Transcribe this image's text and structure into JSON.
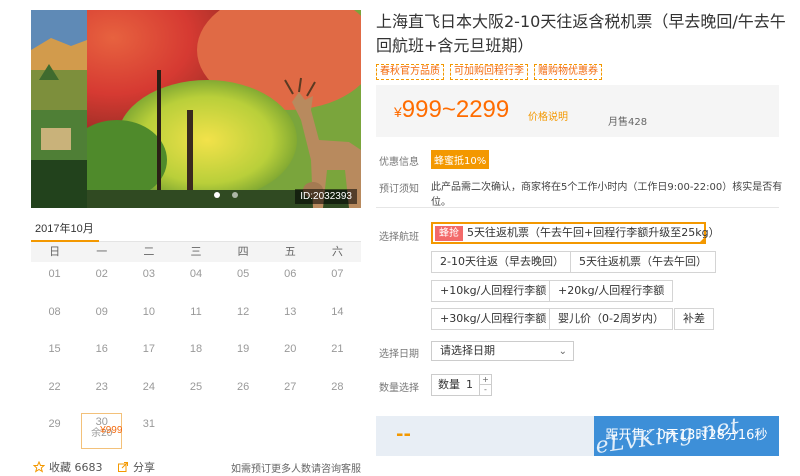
{
  "product": {
    "title": "上海直飞日本大阪2-10天往返含税机票（早去晚回/午去午回航班+含元旦班期）",
    "tags": [
      "春秋官方品质",
      "可加购回程行李",
      "赠购物优惠券"
    ],
    "image_id": "ID:2032393"
  },
  "price": {
    "range": "999~2299",
    "currency": "¥",
    "note": "价格说明",
    "sold": "月售428"
  },
  "promo": {
    "label": "优惠信息",
    "badge": "蜂蜜抵10%"
  },
  "notice": {
    "label": "预订须知",
    "text": "此产品需二次确认，商家将在5个工作小时内（工作日9:00-22:00）核实是否有位。"
  },
  "flight": {
    "label": "选择航班",
    "hot_badge": "蜂抢",
    "options": [
      "5天往返机票（午去午回+回程行李额升级至25kg）",
      "2-10天往返（早去晚回）",
      "5天往返机票（午去午回）",
      "+10kg/人回程行李额",
      "+20kg/人回程行李额",
      "+30kg/人回程行李额",
      "婴儿价（0-2周岁内）",
      "补差"
    ]
  },
  "date": {
    "label": "选择日期",
    "placeholder": "请选择日期"
  },
  "qty": {
    "label": "数量选择",
    "prefix": "数量",
    "value": "1",
    "plus": "+",
    "minus": "-"
  },
  "calendar": {
    "month": "2017年10月",
    "weekdays": [
      "日",
      "一",
      "二",
      "三",
      "四",
      "五",
      "六"
    ],
    "days": [
      "01",
      "02",
      "03",
      "04",
      "05",
      "06",
      "07",
      "08",
      "09",
      "10",
      "11",
      "12",
      "13",
      "14",
      "15",
      "16",
      "17",
      "18",
      "19",
      "20",
      "21",
      "22",
      "23",
      "24",
      "25",
      "26",
      "27",
      "28",
      "29",
      "30",
      "31"
    ],
    "selected": {
      "day": "30",
      "price": "¥999",
      "stock": "余20"
    }
  },
  "footer": {
    "fav": "收藏 6683",
    "share": "分享",
    "note": "如需预订更多人数请咨询客服"
  },
  "buy": {
    "price": "--",
    "button": "距开售：0天13时28分16秒"
  },
  "watermark": "eLvKing.net",
  "colors": {
    "accent": "#f39800",
    "price": "#ff6c00",
    "buy_button": "#3d8fd8"
  }
}
